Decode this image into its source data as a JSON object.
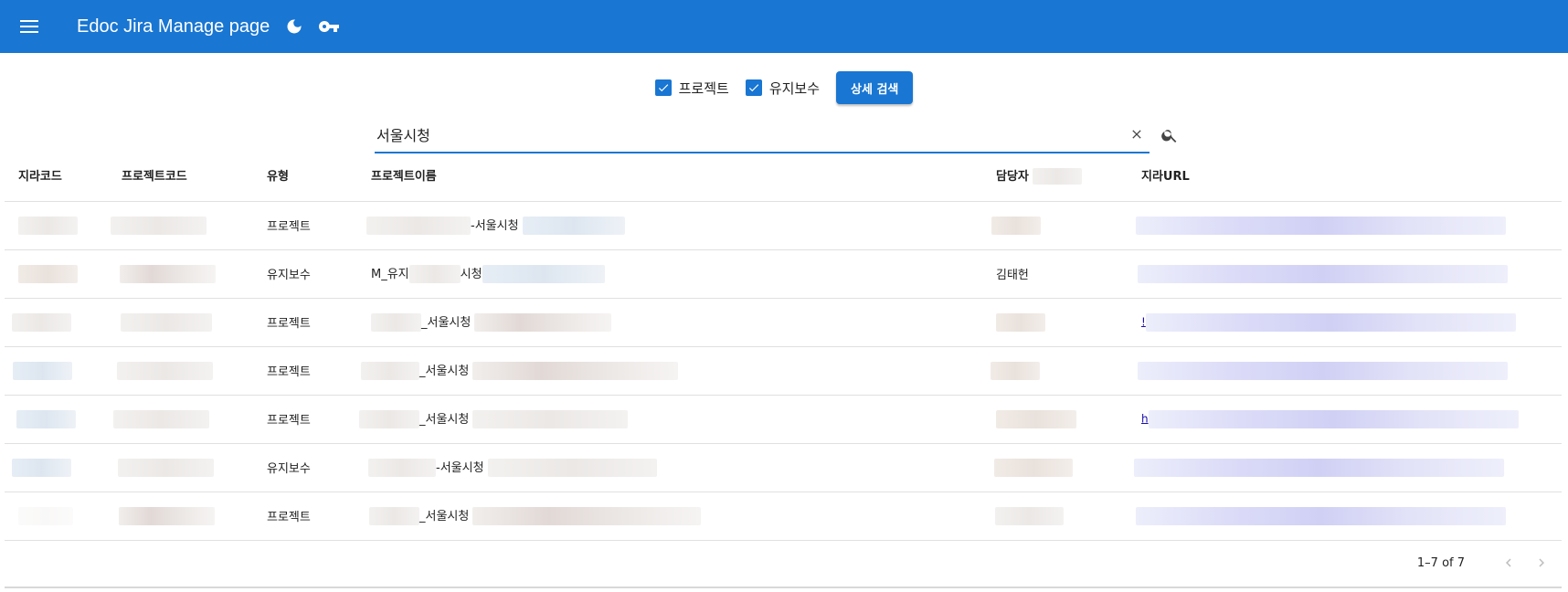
{
  "appbar": {
    "title": "Edoc Jira Manage page",
    "icons": [
      "menu-icon",
      "moon-icon",
      "key-icon"
    ],
    "background": "#1976d2"
  },
  "filters": {
    "project_label": "프로젝트",
    "project_checked": true,
    "maintenance_label": "유지보수",
    "maintenance_checked": true,
    "detail_button": "상세 검색"
  },
  "search": {
    "value": "서울시청",
    "icons": [
      "close-icon",
      "search-icon"
    ]
  },
  "table": {
    "columns": [
      "지라코드",
      "프로젝트코드",
      "유형",
      "프로젝트이름",
      "담당자",
      "지라URL"
    ],
    "rows": [
      {
        "type": "프로젝트",
        "name_visible": "-서울시청",
        "manager": "",
        "link": ""
      },
      {
        "type": "유지보수",
        "name_prefix": "M_유지",
        "name_visible": "시청",
        "manager": "김태헌",
        "link": ""
      },
      {
        "type": "프로젝트",
        "name_visible": "_서울시청",
        "manager": "",
        "link": "!"
      },
      {
        "type": "프로젝트",
        "name_visible": "_서울시청",
        "manager": "",
        "link": ""
      },
      {
        "type": "프로젝트",
        "name_visible": "_서울시청",
        "manager": "",
        "link": "h"
      },
      {
        "type": "유지보수",
        "name_visible": "-서울시청",
        "manager": "",
        "link": ""
      },
      {
        "type": "프로젝트",
        "name_visible": "_서울시청",
        "manager": "",
        "link": ""
      }
    ]
  },
  "pagination": {
    "range": "1–7 of 7",
    "icons": [
      "chevron-left-icon",
      "chevron-right-icon"
    ]
  }
}
